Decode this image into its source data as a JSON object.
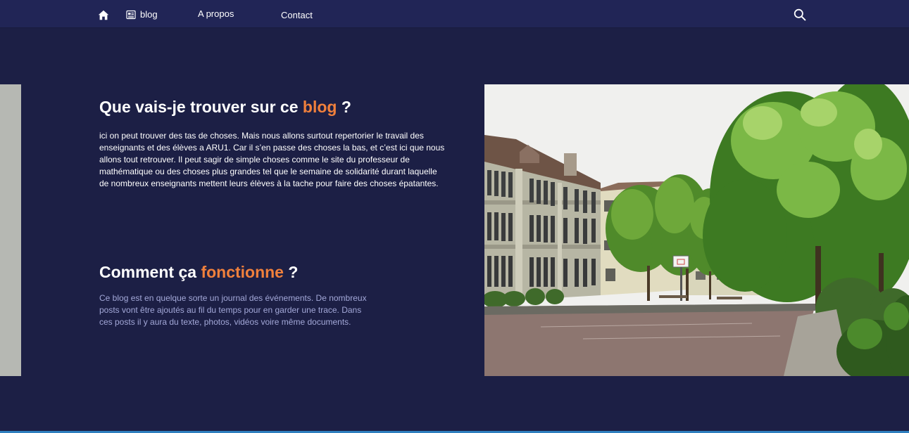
{
  "nav": {
    "home_icon": "home-icon",
    "blog_icon": "newspaper-icon",
    "blog_label": "blog",
    "about_label": "A propos",
    "contact_label": "Contact",
    "search_icon": "search-icon"
  },
  "section1": {
    "title_prefix": "Que vais-je trouver sur ce ",
    "title_accent": "blog",
    "title_suffix": " ?",
    "body": "ici on peut trouver des tas de choses. Mais nous allons surtout repertorier le travail des enseignants et des élèves a ARU1. Car il s’en passe des choses la bas, et c’est ici que nous allons tout retrouver. Il peut sagir de simple choses comme le site du professeur de mathématique ou des choses plus grandes tel que le semaine de solidarité durant laquelle de nombreux enseignants mettent leurs élèves à la tache pour faire des choses épatantes."
  },
  "section2": {
    "title_prefix": "Comment ça ",
    "title_accent": "fonctionne",
    "title_suffix": " ?",
    "body": "Ce blog est en quelque sorte un journal des événements. De nombreux posts vont être ajoutés au fil du temps pour en garder une trace. Dans ces posts il y aura du texte, photos, vidéos voire même documents."
  },
  "colors": {
    "background": "#1c1f45",
    "navbar": "#212556",
    "accent": "#f0803c",
    "muted_text": "#a3a8d8",
    "side_panel": "#b6b8b3"
  }
}
